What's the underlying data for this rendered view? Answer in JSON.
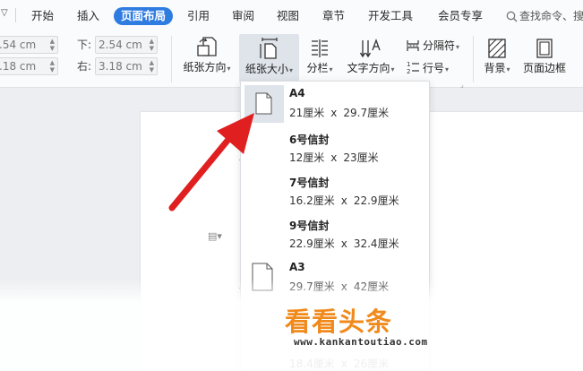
{
  "menubar": {
    "tabs": [
      "开始",
      "插入",
      "页面布局",
      "引用",
      "审阅",
      "视图",
      "章节",
      "开发工具",
      "会员专享"
    ],
    "active_tab": "页面布局",
    "search_text": "查找命令、搜"
  },
  "ribbon": {
    "margins": {
      "top_value": ".54 cm",
      "left_value": ".18 cm",
      "bottom_label": "下:",
      "bottom_value": "2.54 cm",
      "right_label": "右:",
      "right_value": "3.18 cm"
    },
    "orientation_label": "纸张方向",
    "size_label": "纸张大小",
    "columns_label": "分栏",
    "text_direction_label": "文字方向",
    "separator_label": "分隔符",
    "line_number_label": "行号",
    "background_label": "背景",
    "page_border_label": "页面边框"
  },
  "dropdown": {
    "options": [
      {
        "name": "A4",
        "width": "21厘米",
        "height": "29.7厘米",
        "selected": true
      },
      {
        "name": "6号信封",
        "width": "12厘米",
        "height": "23厘米",
        "selected": false
      },
      {
        "name": "7号信封",
        "width": "16.2厘米",
        "height": "22.9厘米",
        "selected": false
      },
      {
        "name": "9号信封",
        "width": "22.9厘米",
        "height": "32.4厘米",
        "selected": false
      },
      {
        "name": "A3",
        "width": "29.7厘米",
        "height": "42厘米",
        "selected": false
      }
    ],
    "partial_bottom": {
      "width": "18.4厘米",
      "height": "26厘米"
    },
    "times_symbol": "x"
  },
  "watermark": {
    "logo": "看看头条",
    "url": "www.kankantoutiao.com"
  },
  "colors": {
    "accent_blue": "#2f7ce0",
    "annotation_arrow": "#e02020",
    "selection_bg": "#dfe4eb",
    "watermark_orange": "#f08a1c"
  },
  "icons": {
    "search": "search-icon",
    "orientation": "page-orientation-icon",
    "size": "paper-size-icon",
    "columns": "columns-icon",
    "text_direction": "text-direction-icon",
    "separator": "separator-icon",
    "line_number": "line-number-icon",
    "background": "background-icon",
    "page_border": "page-border-icon",
    "page": "page-icon"
  }
}
